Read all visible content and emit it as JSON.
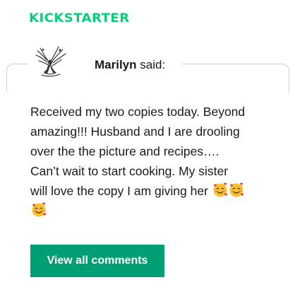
{
  "brand": {
    "logo_text": "KICKSTARTER",
    "color": "#05ce78"
  },
  "comment": {
    "author": "Marilyn",
    "said_suffix": "said:",
    "lines": [
      "Received my two copies today. Beyond",
      "amazing!!! Husband and I are drooling",
      "over the the picture and recipes….",
      "Can’t wait to start cooking. My sister",
      "will love the copy I am giving her"
    ],
    "emoji_names": [
      "smiling-face-with-hearts-icon",
      "smiling-face-with-hearts-icon",
      "smiling-face-with-hearts-icon"
    ]
  },
  "cta": {
    "label": "View all comments",
    "color": "#009e74"
  }
}
